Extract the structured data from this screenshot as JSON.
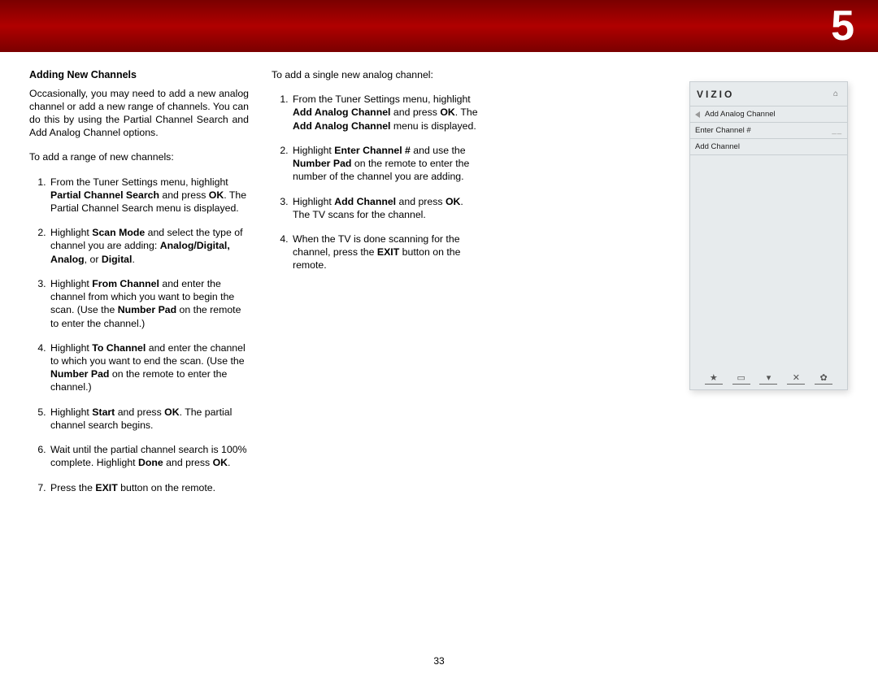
{
  "header": {
    "section_number": "5"
  },
  "page_number": "33",
  "col1": {
    "heading": "Adding New Channels",
    "intro_html": "Occasionally, you may need to add a new analog channel or add a new range of channels. You can do this by using the Partial Channel Search and Add Analog Channel options.",
    "lead": "To add a range of new channels:",
    "steps": [
      "From the Tuner Settings menu, highlight <b>Partial Channel Search</b> and press <b>OK</b>. The Partial Channel Search menu is displayed.",
      "Highlight <b>Scan Mode</b> and select the type of channel you are adding: <b>Analog/Digital, Analog</b>, or <b>Digital</b>.",
      "Highlight <b>From Channel</b> and enter the channel from which you want to begin the scan. (Use the <b>Number Pad</b> on the remote to enter the channel.)",
      "Highlight <b>To Channel</b> and enter the channel to which you want to end the scan. (Use the <b>Number Pad</b> on the remote to enter the channel.)",
      "Highlight <b>Start</b> and press <b>OK</b>. The partial channel search begins.",
      "Wait until the partial channel search is 100% complete. Highlight <b>Done</b> and press <b>OK</b>.",
      "Press the <b>EXIT</b> button on the remote."
    ]
  },
  "col2": {
    "lead": "To add a single new analog channel:",
    "steps": [
      "From the Tuner Settings menu, highlight <b>Add Analog Channel</b> and press <b>OK</b>. The <b>Add Analog Channel</b> menu is displayed.",
      "Highlight <b>Enter Channel #</b> and use the <b>Number Pad</b> on the remote to enter the number of the channel you are adding.",
      "Highlight <b>Add Channel</b> and press <b>OK</b>. The TV scans for the channel.",
      "When the TV is done scanning for the channel, press the <b>EXIT</b> button on the remote."
    ]
  },
  "osd": {
    "brand": "VIZIO",
    "crumb": "Add Analog Channel",
    "row_enter_label": "Enter Channel #",
    "row_enter_value": "__",
    "row_add": "Add Channel",
    "footer_icons": [
      "★",
      "▭",
      "▾",
      "✕",
      "✿"
    ]
  }
}
